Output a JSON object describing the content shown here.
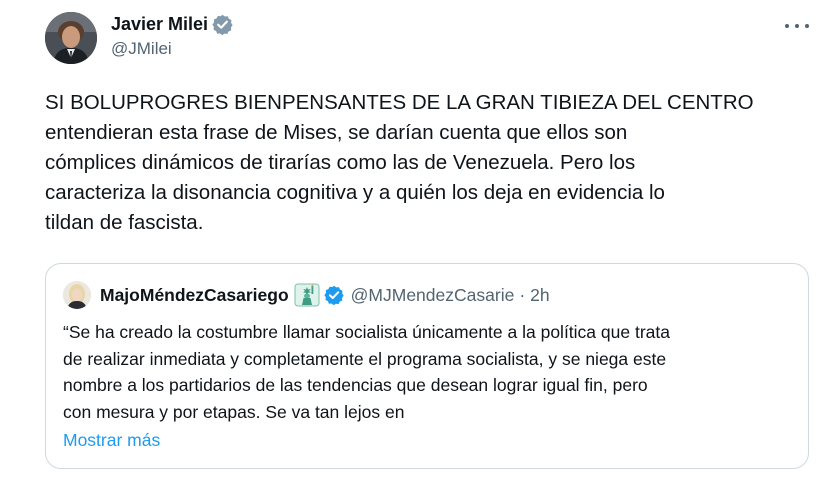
{
  "tweet": {
    "author": {
      "name": "Javier Milei",
      "handle": "@JMilei",
      "verified_color": "#829aab"
    },
    "text": "SI BOLUPROGRES BIENPENSANTES DE LA GRAN TIBIEZA DEL CENTRO\nentendieran esta frase de Mises, se darían cuenta que ellos son\ncómplices dinámicos de tirarías como las de Venezuela. Pero los\ncaracteriza la disonancia cognitiva y a quién los deja en evidencia lo\ntildan de fascista.",
    "more_icon": "more-horizontal-icon"
  },
  "quoted_tweet": {
    "name": "MajoMéndezCasariego",
    "badge_icon": "statue-of-liberty-icon",
    "verified_color": "#1d9bf0",
    "handle": "@MJMendezCasarie",
    "separator": "·",
    "time": "2h",
    "text": "“Se ha creado la costumbre llamar socialista únicamente a la política que trata\nde realizar inmediata y completamente el programa socialista, y se niega este\nnombre a los partidarios de las tendencias que desean lograr igual fin, pero\ncon mesura y por etapas. Se va tan lejos en",
    "show_more": "Mostrar más",
    "link_color": "#1d9bf0"
  }
}
